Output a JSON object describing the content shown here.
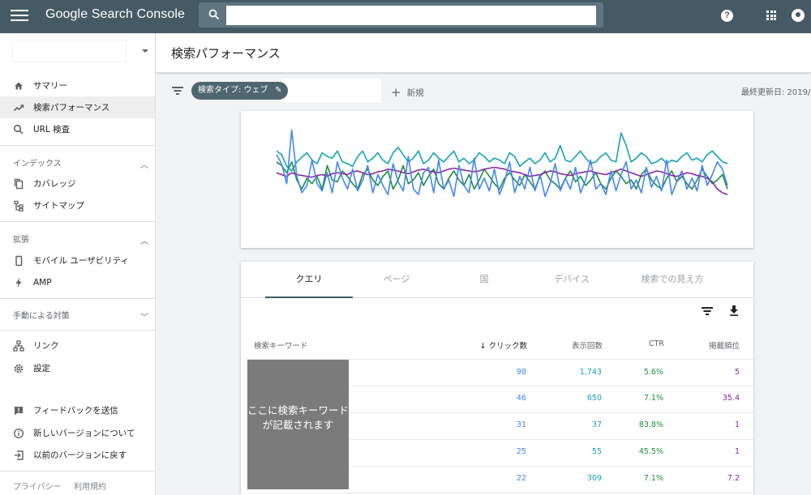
{
  "app": {
    "title": "Google Search Console"
  },
  "search": {
    "placeholder": "",
    "value": ""
  },
  "sidebar": {
    "items": [
      {
        "label": "サマリー",
        "icon": "home-icon"
      },
      {
        "label": "検索パフォーマンス",
        "icon": "trending-up-icon"
      },
      {
        "label": "URL 検査",
        "icon": "search-icon"
      }
    ],
    "sections": [
      {
        "label": "インデックス",
        "expanded": true,
        "items": [
          {
            "label": "カバレッジ",
            "icon": "copy-icon"
          },
          {
            "label": "サイトマップ",
            "icon": "sitemap-icon"
          }
        ]
      },
      {
        "label": "拡張",
        "expanded": true,
        "items": [
          {
            "label": "モバイル ユーザビリティ",
            "icon": "phone-icon"
          },
          {
            "label": "AMP",
            "icon": "bolt-icon"
          }
        ]
      },
      {
        "label": "手動による対策",
        "expanded": false,
        "items": []
      }
    ],
    "more": [
      {
        "label": "リンク",
        "icon": "links-icon"
      },
      {
        "label": "設定",
        "icon": "gear-icon"
      }
    ],
    "bottom": [
      {
        "label": "フィードバックを送信",
        "icon": "feedback-icon"
      },
      {
        "label": "新しいバージョンについて",
        "icon": "info-icon"
      },
      {
        "label": "以前のバージョンに戻す",
        "icon": "exit-icon"
      }
    ],
    "footer": {
      "privacy": "プライバシー",
      "terms": "利用規約"
    }
  },
  "header": {
    "title": "検索パフォーマンス"
  },
  "filterbar": {
    "chip_label": "検索タイプ: ウェブ",
    "new_label": "新規",
    "last_updated": "最終更新日: 2019/0"
  },
  "colors": {
    "topbar": "#455a64",
    "clicks": "#4285f4",
    "impressions": "#12a4b4",
    "ctr": "#1e8e3e",
    "position": "#8e24aa"
  },
  "chart_data": {
    "type": "line",
    "title": "",
    "xlabel": "",
    "ylabel": "",
    "grid": false,
    "legend": "none",
    "x": [
      1,
      2,
      3,
      4,
      5,
      6,
      7,
      8,
      9,
      10,
      11,
      12,
      13,
      14,
      15,
      16,
      17,
      18,
      19,
      20,
      21,
      22,
      23,
      24,
      25,
      26,
      27,
      28,
      29,
      30,
      31,
      32,
      33,
      34,
      35,
      36,
      37,
      38,
      39,
      40,
      41,
      42,
      43,
      44,
      45,
      46,
      47,
      48,
      49,
      50,
      51,
      52,
      53,
      54,
      55,
      56,
      57,
      58,
      59,
      60,
      61,
      62,
      63,
      64,
      65,
      66,
      67,
      68,
      69,
      70,
      71,
      72,
      73,
      74,
      75,
      76,
      77,
      78,
      79,
      80,
      81,
      82,
      83,
      84,
      85,
      86,
      87,
      88,
      89,
      90
    ],
    "series": [
      {
        "color": "#12a4b4",
        "values": [
          72,
          68,
          55,
          50,
          60,
          65,
          70,
          62,
          58,
          70,
          66,
          64,
          72,
          60,
          58,
          55,
          66,
          72,
          60,
          64,
          70,
          62,
          58,
          70,
          76,
          68,
          60,
          64,
          72,
          58,
          62,
          70,
          64,
          60,
          66,
          72,
          60,
          64,
          58,
          62,
          70,
          66,
          60,
          64,
          62,
          58,
          70,
          66,
          55,
          60,
          64,
          58,
          62,
          70,
          60,
          64,
          78,
          62,
          60,
          66,
          72,
          64,
          58,
          60,
          66,
          70,
          62,
          60,
          92,
          78,
          60,
          64,
          70,
          66,
          58,
          60,
          64,
          58,
          62,
          60,
          66,
          70,
          62,
          64,
          60,
          68,
          72,
          66,
          60,
          58
        ]
      },
      {
        "color": "#1e8e3e",
        "values": [
          60,
          56,
          48,
          60,
          40,
          30,
          42,
          36,
          44,
          30,
          56,
          40,
          38,
          50,
          44,
          36,
          30,
          46,
          52,
          40,
          34,
          44,
          50,
          30,
          40,
          56,
          36,
          40,
          48,
          34,
          44,
          52,
          36,
          30,
          42,
          50,
          40,
          34,
          46,
          30,
          40,
          52,
          44,
          36,
          30,
          42,
          48,
          40,
          34,
          46,
          38,
          30,
          44,
          50,
          40,
          36,
          30,
          42,
          50,
          38,
          44,
          34,
          40,
          48,
          36,
          30,
          42,
          50,
          44,
          36,
          40,
          30,
          46,
          52,
          40,
          34,
          30,
          42,
          50,
          38,
          44,
          36,
          30,
          40,
          52,
          44,
          36,
          40,
          46,
          30
        ]
      },
      {
        "color": "#8e24aa",
        "values": [
          48,
          46,
          44,
          48,
          46,
          45,
          44,
          43,
          45,
          46,
          44,
          47,
          48,
          47,
          46,
          49,
          50,
          48,
          46,
          47,
          49,
          50,
          52,
          51,
          50,
          48,
          47,
          49,
          51,
          52,
          50,
          49,
          48,
          50,
          52,
          53,
          52,
          51,
          50,
          49,
          50,
          52,
          53,
          54,
          53,
          52,
          50,
          49,
          48,
          46,
          44,
          45,
          46,
          48,
          50,
          49,
          47,
          46,
          45,
          47,
          48,
          49,
          50,
          48,
          47,
          46,
          48,
          50,
          52,
          50,
          48,
          46,
          44,
          46,
          48,
          50,
          49,
          47,
          45,
          44,
          46,
          48,
          47,
          45,
          44,
          42,
          38,
          30,
          26,
          24
        ]
      },
      {
        "color": "#4285f4",
        "values": [
          68,
          58,
          36,
          95,
          44,
          26,
          34,
          62,
          36,
          28,
          48,
          26,
          60,
          42,
          30,
          52,
          28,
          40,
          56,
          26,
          46,
          34,
          24,
          58,
          38,
          28,
          66,
          30,
          24,
          48,
          54,
          26,
          62,
          30,
          40,
          22,
          56,
          34,
          26,
          64,
          30,
          42,
          28,
          52,
          24,
          38,
          60,
          26,
          44,
          30,
          54,
          28,
          46,
          22,
          36,
          58,
          28,
          42,
          30,
          54,
          26,
          40,
          62,
          30,
          36,
          24,
          50,
          28,
          46,
          60,
          30,
          40,
          26,
          54,
          32,
          44,
          28,
          62,
          24,
          38,
          50,
          30,
          42,
          28,
          56,
          34,
          46,
          60,
          52,
          34
        ]
      }
    ]
  },
  "table": {
    "tabs": [
      "クエリ",
      "ページ",
      "国",
      "デバイス",
      "検索での見え方"
    ],
    "active_tab": 0,
    "columns": [
      "検索キーワード",
      "クリック数",
      "表示回数",
      "CTR",
      "掲載順位"
    ],
    "sorted_column": "クリック数",
    "rows": [
      {
        "clicks": "98",
        "impressions": "1,743",
        "ctr": "5.6%",
        "position": "5"
      },
      {
        "clicks": "46",
        "impressions": "650",
        "ctr": "7.1%",
        "position": "35.4"
      },
      {
        "clicks": "31",
        "impressions": "37",
        "ctr": "83.8%",
        "position": "1"
      },
      {
        "clicks": "25",
        "impressions": "55",
        "ctr": "45.5%",
        "position": "1"
      },
      {
        "clicks": "22",
        "impressions": "309",
        "ctr": "7.1%",
        "position": "7.2"
      }
    ],
    "keyword_overlay": "ここに検索キーワードが記載されます"
  }
}
